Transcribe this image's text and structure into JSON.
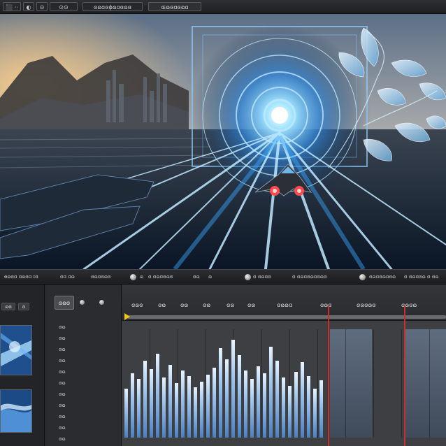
{
  "window": {
    "menu_items": [
      "⬛ ⋅⋅",
      "◐",
      "⊙",
      "⊙⊙"
    ],
    "title": "ɞɷɑɞɸɷɑɞɷɞ",
    "search_placeholder": "ɶɷɞɑɞɷɑ"
  },
  "viewer": {
    "scene": "futuristic spaceship racing through blue energy tunnel",
    "colors": {
      "accent": "#3aa8ff",
      "glow": "#c9f1ff",
      "warm": "#d9823a"
    }
  },
  "statusbar": {
    "items": [
      "ɵɷɞɑ ɑɷɞɑ ɪɞ",
      "ɞɑ ɑɷ",
      "ɞɷɑɞɷɞ",
      "ɷ",
      "ɞ ɞɷɑɞɷɞ",
      "ɞɷ",
      "ɷ",
      "ɞ ɞɷɑɞ",
      "ɞ ɞɷɑɞɷɑɞɷɞ",
      "ɞɷɑɞɷɑɞɷ",
      "ɞ ɞɷɑɞɷ ɞ ɞɷ"
    ]
  },
  "sidepanel": {
    "tabs": [
      "ɷɞ",
      "ɞ"
    ]
  },
  "track_header": {
    "title": "ɞɷɞ",
    "rows": [
      "ɞɷ",
      "ɞɷ",
      "ɞɷ",
      "ɞɷ",
      "ɞɷ",
      "ɞɷ",
      "ɞɷ",
      "ɞɷ",
      "ɞɷ",
      "ɞɷ",
      "ɞɷ"
    ]
  },
  "timeline": {
    "ruler_labels": [
      "ɞɷɞ",
      "ɞɷ",
      "ɞɷ",
      "ɞɷ",
      "ɞɷ",
      "ɞɷ",
      "ɞɷɷɑ",
      "ɞɷɞ",
      "ɞɷɞɷɞ",
      "ɞɷɞɷ"
    ],
    "colors": {
      "playhead": "#c6312b",
      "waveform": "#9fc4ec"
    }
  }
}
